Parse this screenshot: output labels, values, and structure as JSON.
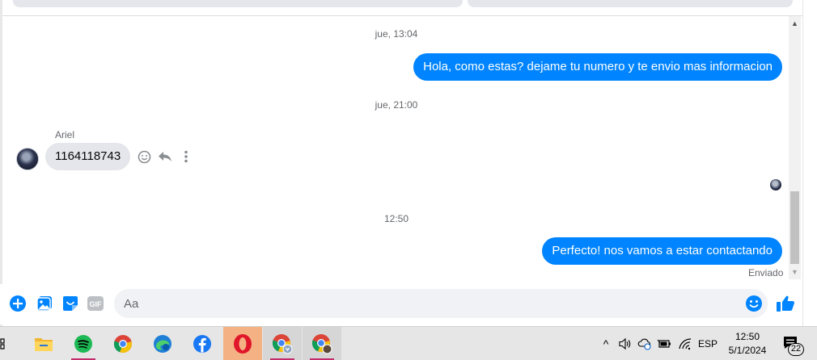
{
  "chat": {
    "timestamps": [
      "jue, 13:04",
      "jue, 21:00",
      "12:50"
    ],
    "messages": [
      {
        "direction": "outgoing",
        "text": "Hola, como estas? dejame tu numero y te envio mas informacion"
      },
      {
        "direction": "incoming",
        "sender": "Ariel",
        "text": "1164118743"
      },
      {
        "direction": "outgoing",
        "text": "Perfecto! nos vamos a estar contactando"
      }
    ],
    "status": "Enviado"
  },
  "composer": {
    "placeholder": "Aa",
    "value": "",
    "icons": [
      "add-icon",
      "photo-icon",
      "sticker-icon",
      "gif-icon",
      "emoji-icon",
      "like-icon"
    ],
    "gif_label": "GIF"
  },
  "taskbar": {
    "apps": [
      "task-view-icon",
      "file-explorer-icon",
      "spotify-icon",
      "chrome-icon",
      "edge-icon",
      "facebook-icon",
      "opera-icon",
      "chrome-profile-icon",
      "chrome-profile-icon"
    ],
    "tray": {
      "chevron": "^",
      "language": "ESP",
      "time": "12:50",
      "date": "5/1/2024",
      "notifications": "22"
    }
  },
  "colors": {
    "accent": "#0084ff",
    "incoming_bubble": "#e4e6eb",
    "taskbar": "#e6e6e6",
    "opera_active": "#f4b183"
  }
}
